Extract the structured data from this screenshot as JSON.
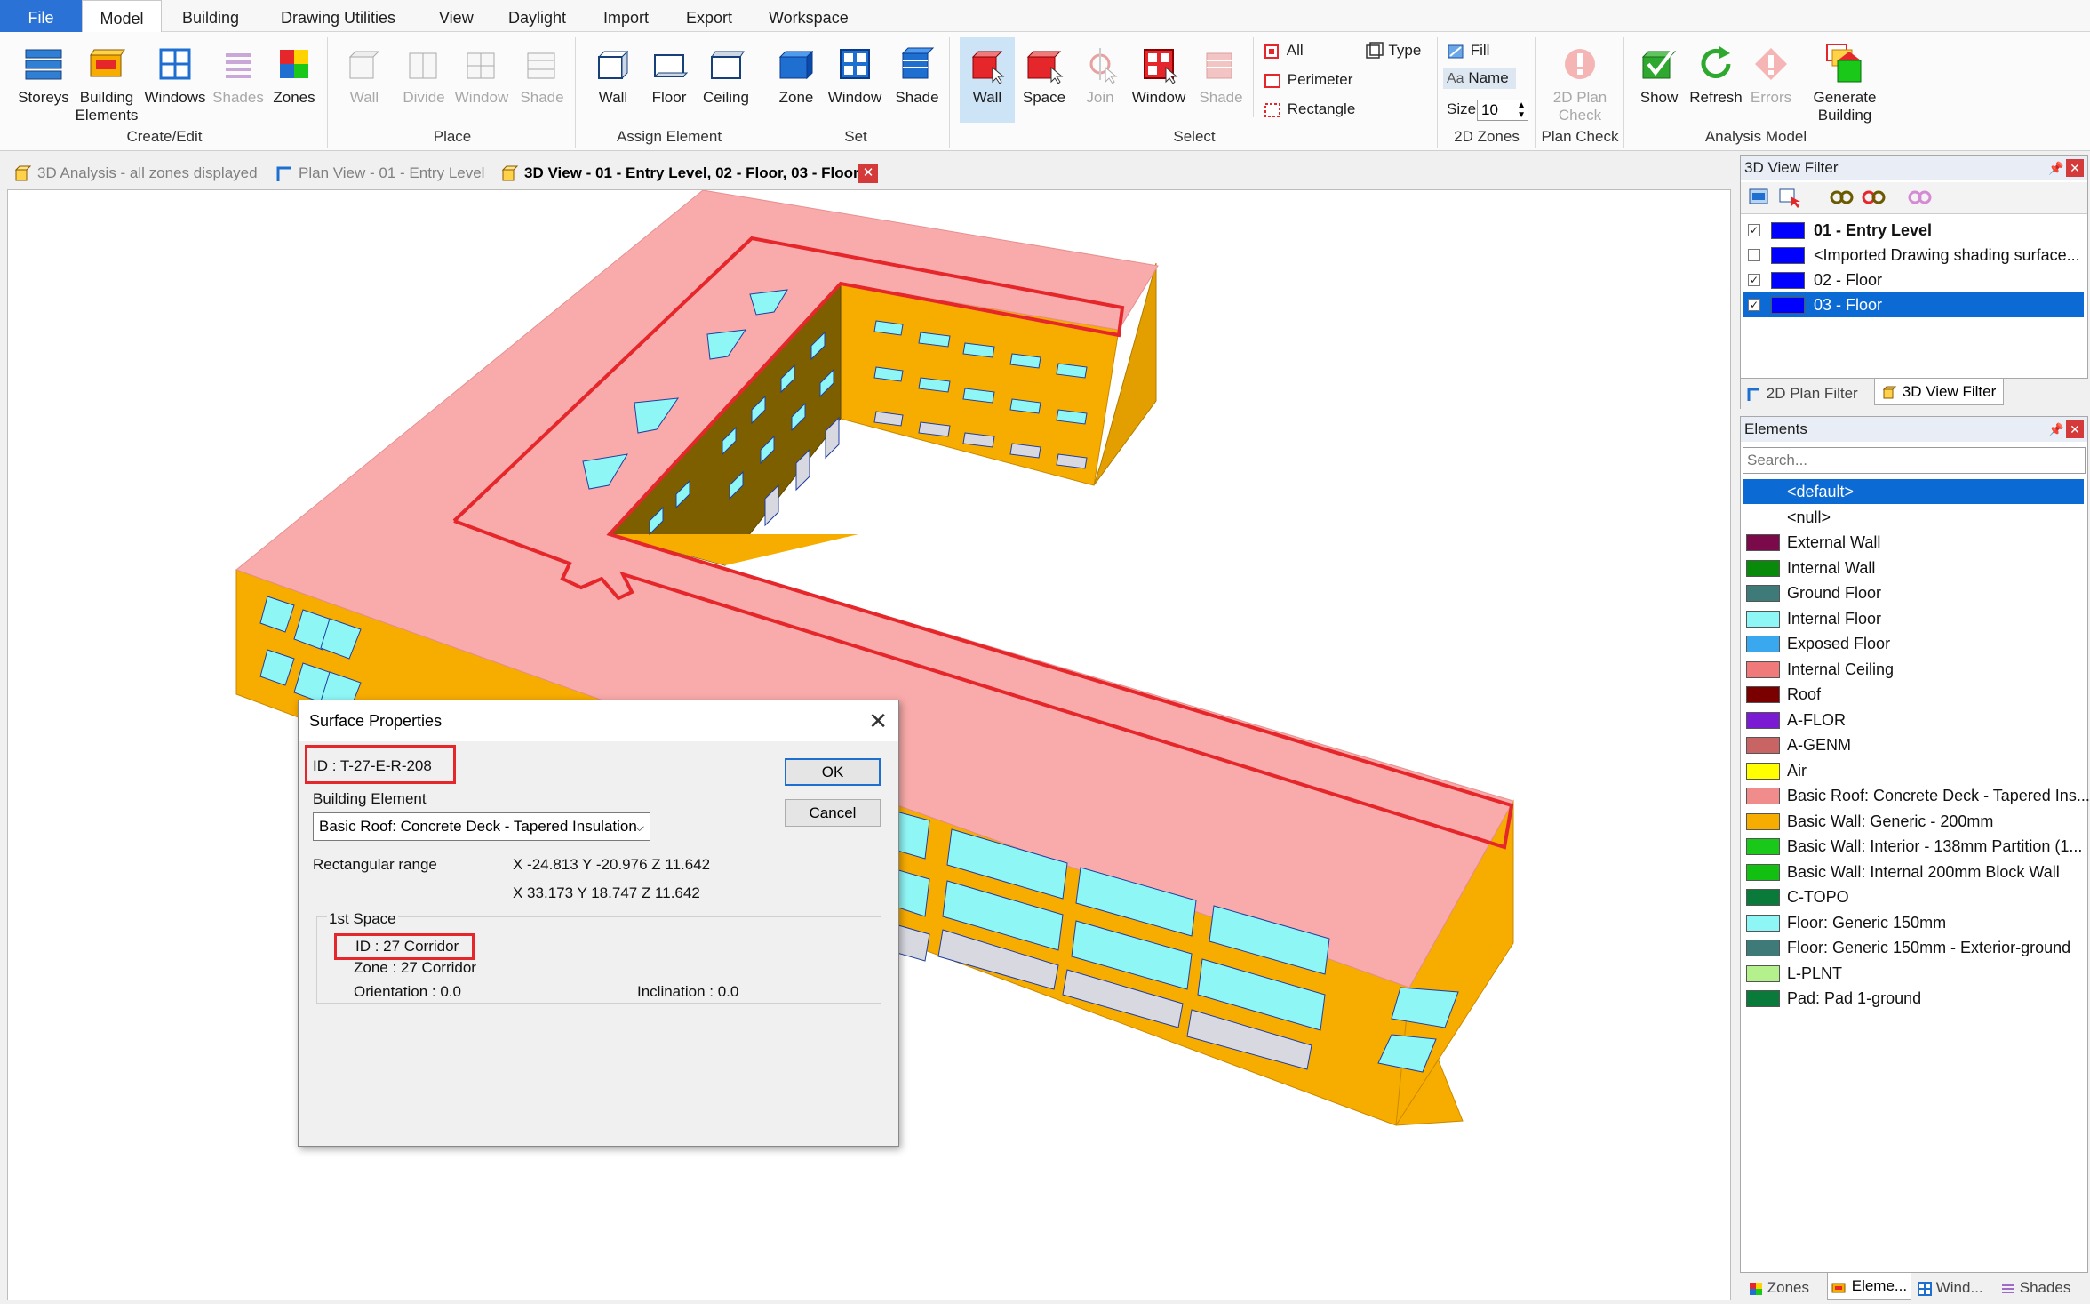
{
  "menu": {
    "file": "File",
    "model": "Model",
    "building": "Building",
    "drawing_utilities": "Drawing Utilities",
    "view": "View",
    "daylight": "Daylight",
    "import": "Import",
    "export": "Export",
    "workspace": "Workspace"
  },
  "ribbon": {
    "create_edit": {
      "storeys": "Storeys",
      "building_elements": "Building Elements",
      "windows": "Windows",
      "shades": "Shades",
      "zones": "Zones",
      "label": "Create/Edit"
    },
    "place": {
      "wall": "Wall",
      "divide": "Divide",
      "window": "Window",
      "shade": "Shade",
      "label": "Place"
    },
    "assign": {
      "wall": "Wall",
      "floor": "Floor",
      "ceiling": "Ceiling",
      "label": "Assign Element"
    },
    "set": {
      "zone": "Zone",
      "window": "Window",
      "shade": "Shade",
      "label": "Set"
    },
    "select": {
      "wall": "Wall",
      "space": "Space",
      "join": "Join",
      "window": "Window",
      "shade": "Shade",
      "all": "All",
      "perimeter": "Perimeter",
      "rectangle": "Rectangle",
      "type": "Type",
      "label": "Select"
    },
    "zones2d": {
      "fill": "Fill",
      "name": "Name",
      "size_label": "Size",
      "size_value": "10",
      "label": "2D Zones"
    },
    "plancheck": {
      "btn": "2D Plan Check",
      "label": "Plan Check"
    },
    "analysis": {
      "show": "Show",
      "refresh": "Refresh",
      "errors": "Errors",
      "generate": "Generate Building",
      "label": "Analysis Model"
    }
  },
  "doc_tabs": [
    {
      "label": "3D Analysis - all zones displayed",
      "active": false
    },
    {
      "label": "Plan View - 01 - Entry Level",
      "active": false
    },
    {
      "label": "3D View - 01 - Entry Level, 02 - Floor, 03 - Floor",
      "active": true
    }
  ],
  "view_filter": {
    "title": "3D View Filter",
    "items": [
      {
        "label": "01 - Entry Level",
        "checked": true,
        "bold": true,
        "color": "#0000ff"
      },
      {
        "label": "<Imported Drawing shading surface...",
        "checked": false,
        "bold": false,
        "color": "#0000ff"
      },
      {
        "label": "02 - Floor",
        "checked": true,
        "bold": false,
        "color": "#0000ff"
      },
      {
        "label": "03 - Floor",
        "checked": true,
        "bold": false,
        "color": "#0000ff",
        "selected": true
      }
    ],
    "tabs": {
      "plan": "2D Plan Filter",
      "view3d": "3D View Filter"
    }
  },
  "elements": {
    "title": "Elements",
    "search_placeholder": "Search...",
    "items": [
      {
        "label": "<default>",
        "color": "",
        "selected": true
      },
      {
        "label": "<null>",
        "color": ""
      },
      {
        "label": "External Wall",
        "color": "#7a0a4a"
      },
      {
        "label": "Internal Wall",
        "color": "#0a8a0a"
      },
      {
        "label": "Ground Floor",
        "color": "#3d7a78"
      },
      {
        "label": "Internal Floor",
        "color": "#8ff6f6"
      },
      {
        "label": "Exposed Floor",
        "color": "#3aa8ee"
      },
      {
        "label": "Internal Ceiling",
        "color": "#f07a7a"
      },
      {
        "label": "Roof",
        "color": "#7a0000"
      },
      {
        "label": "A-FLOR",
        "color": "#7a1ad2"
      },
      {
        "label": "A-GENM",
        "color": "#c86464"
      },
      {
        "label": "Air",
        "color": "#ffff00"
      },
      {
        "label": "Basic Roof: Concrete Deck - Tapered Ins...",
        "color": "#f08c8c"
      },
      {
        "label": "Basic Wall: Generic - 200mm",
        "color": "#f7ac00"
      },
      {
        "label": "Basic Wall: Interior - 138mm Partition (1...",
        "color": "#1ac81a"
      },
      {
        "label": "Basic Wall: Internal 200mm Block Wall",
        "color": "#12c012"
      },
      {
        "label": "C-TOPO",
        "color": "#0a7a3a"
      },
      {
        "label": "Floor: Generic 150mm",
        "color": "#8ff6f6"
      },
      {
        "label": "Floor: Generic 150mm - Exterior-ground",
        "color": "#3d7a78"
      },
      {
        "label": "L-PLNT",
        "color": "#b4f08c"
      },
      {
        "label": "Pad: Pad 1-ground",
        "color": "#0a7a3a"
      }
    ]
  },
  "bottom_tabs": [
    {
      "label": "Zones",
      "active": false
    },
    {
      "label": "Eleme...",
      "active": true
    },
    {
      "label": "Wind...",
      "active": false
    },
    {
      "label": "Shades",
      "active": false
    }
  ],
  "dialog": {
    "title": "Surface Properties",
    "id_line": "ID   : T-27-E-R-208",
    "building_element_label": "Building Element",
    "building_element_value": "Basic Roof: Concrete Deck - Tapered Insulation",
    "range_label": "Rectangular range",
    "range_line1": "X -24.813  Y -20.976  Z 11.642",
    "range_line2": "X 33.173  Y 18.747  Z 11.642",
    "first_space_label": "1st Space",
    "space_id": "ID   : 27 Corridor",
    "zone_line": "Zone  :  27 Corridor",
    "orientation_line": "Orientation  :    0.0",
    "inclination_line": "Inclination  :    0.0",
    "ok": "OK",
    "cancel": "Cancel"
  }
}
